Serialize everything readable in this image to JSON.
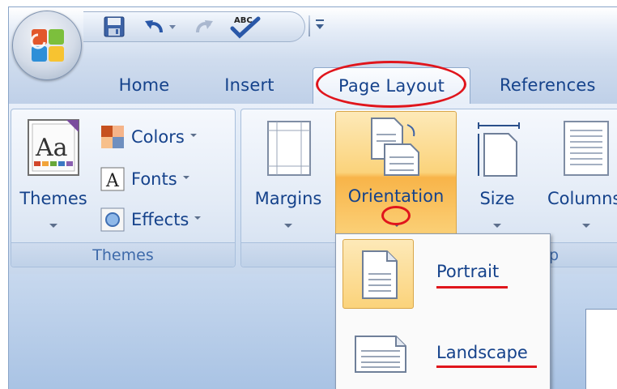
{
  "ribbon_tabs": [
    "Home",
    "Insert",
    "Page Layout",
    "References"
  ],
  "active_tab": "Page Layout",
  "themes_group": {
    "themes_label": "Themes",
    "colors_label": "Colors",
    "fonts_label": "Fonts",
    "effects_label": "Effects",
    "group_label": "Themes",
    "themes_icon_text": "Aa",
    "fonts_icon_text": "A"
  },
  "page_setup_group": {
    "margins_label": "Margins",
    "orientation_label": "Orientation",
    "size_label": "Size",
    "columns_label": "Columns",
    "group_label_partial": "up"
  },
  "orientation_menu": {
    "items": [
      "Portrait",
      "Landscape"
    ],
    "selected": "Portrait"
  },
  "quick_access": {
    "spelling_icon_text": "ABC"
  },
  "colors": {
    "annotation_red": "#e0151c",
    "ribbon_text": "#15428b",
    "highlight_orange": "#f8b449"
  },
  "icons": [
    "office-logo",
    "save-icon",
    "undo-icon",
    "redo-icon",
    "spelling-icon",
    "customize-qat-icon",
    "themes-icon",
    "colors-icon",
    "fonts-icon",
    "effects-icon",
    "margins-icon",
    "orientation-icon",
    "size-icon",
    "columns-icon",
    "portrait-icon",
    "landscape-icon"
  ]
}
